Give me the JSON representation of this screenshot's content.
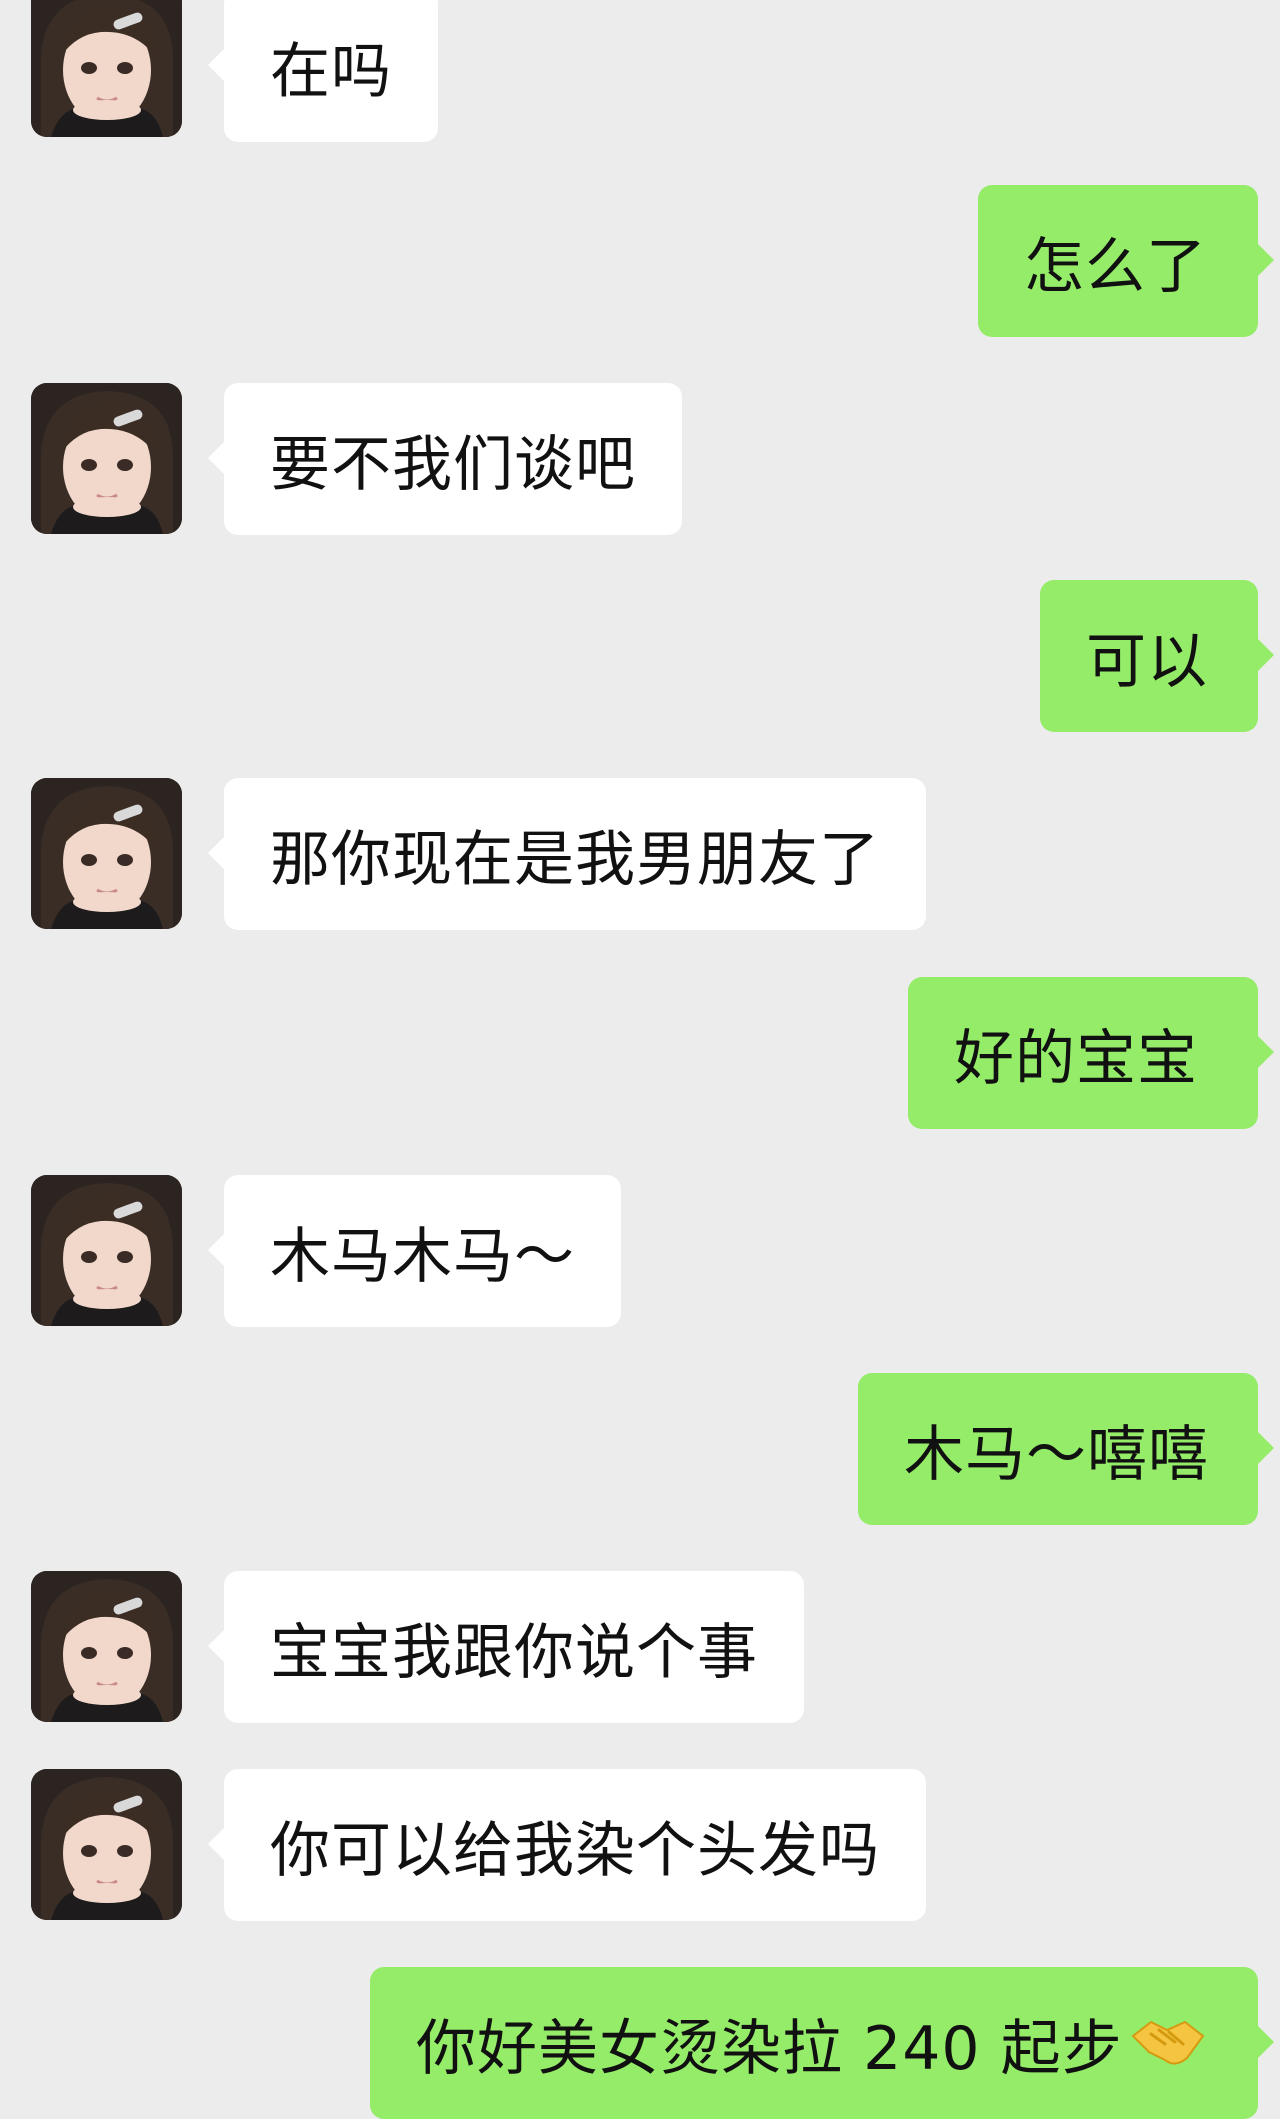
{
  "messages": [
    {
      "side": "in",
      "text": "在吗"
    },
    {
      "side": "out",
      "text": "怎么了"
    },
    {
      "side": "in",
      "text": "要不我们谈吧"
    },
    {
      "side": "out",
      "text": "可以"
    },
    {
      "side": "in",
      "text": "那你现在是我男朋友了"
    },
    {
      "side": "out",
      "text": "好的宝宝"
    },
    {
      "side": "in",
      "text": "木马木马～"
    },
    {
      "side": "out",
      "text": "木马～嘻嘻"
    },
    {
      "side": "in",
      "text": "宝宝我跟你说个事"
    },
    {
      "side": "in",
      "text": "你可以给我染个头发吗"
    },
    {
      "side": "out",
      "text": "你好美女烫染拉 240 起步",
      "emoji": "handshake-emoji"
    }
  ],
  "colors": {
    "background": "#ececec",
    "incoming_bubble": "#ffffff",
    "outgoing_bubble": "#95ec69",
    "text": "#111111"
  },
  "icons": {
    "avatar": "girl-avatar-photo"
  }
}
